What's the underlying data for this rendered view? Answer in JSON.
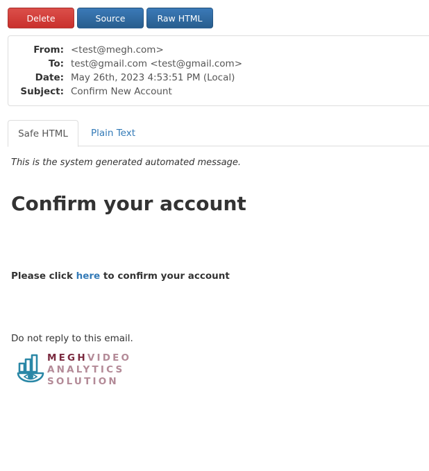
{
  "toolbar": {
    "delete_label": "Delete",
    "source_label": "Source",
    "raw_label": "Raw HTML"
  },
  "headers": {
    "from_label": "From:",
    "from_value": "<test@megh.com>",
    "to_label": "To:",
    "to_value": "test@gmail.com <test@gmail.com>",
    "date_label": "Date:",
    "date_value": "May 26th, 2023 4:53:51 PM (Local)",
    "subject_label": "Subject:",
    "subject_value": "Confirm New Account"
  },
  "tabs": {
    "safe_html": "Safe HTML",
    "plain_text": "Plain Text"
  },
  "message": {
    "system_note": "This is the system generated automated message.",
    "headline": "Confirm your account",
    "confirm_prefix": "Please click ",
    "confirm_link": "here",
    "confirm_suffix": " to confirm your account",
    "no_reply": "Do not reply to this email."
  },
  "logo": {
    "line1_a": "MEGH",
    "line1_b": "VIDEO",
    "line2": "ANALYTICS",
    "line3": "SOLUTION",
    "icon": "megh-camera-chart-icon"
  },
  "colors": {
    "danger": "#c9302c",
    "primary": "#286090",
    "link": "#337ab7",
    "logo_dark": "#7a2a3f",
    "logo_light": "#b38a97",
    "logo_icon": "#2a87a6"
  }
}
